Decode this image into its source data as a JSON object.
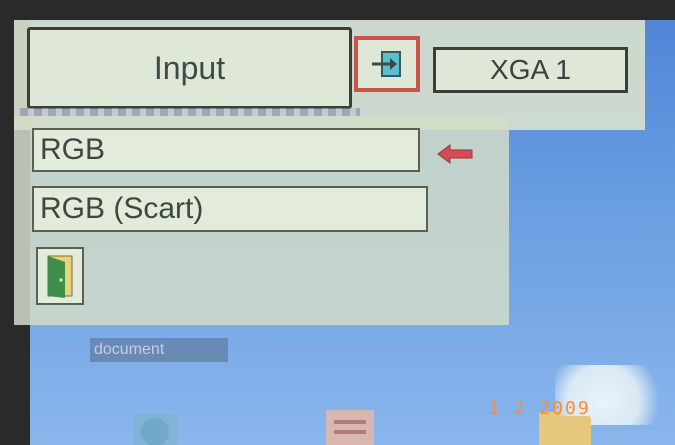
{
  "header": {
    "input_label": "Input",
    "source_icon": "input-source-icon",
    "signal_label": "XGA 1"
  },
  "options": [
    {
      "label": "RGB",
      "selected": true
    },
    {
      "label": "RGB (Scart)",
      "selected": false
    }
  ],
  "icons": {
    "selection_arrow": "left-arrow-icon",
    "exit": "exit-door-icon"
  },
  "background": {
    "desktop_label": "document",
    "camera_date": "1 2 2009"
  },
  "colors": {
    "accent": "#c9544a",
    "panel": "#dfe7d6",
    "sky": "#6a9fe2",
    "date": "#ff8c2a"
  }
}
